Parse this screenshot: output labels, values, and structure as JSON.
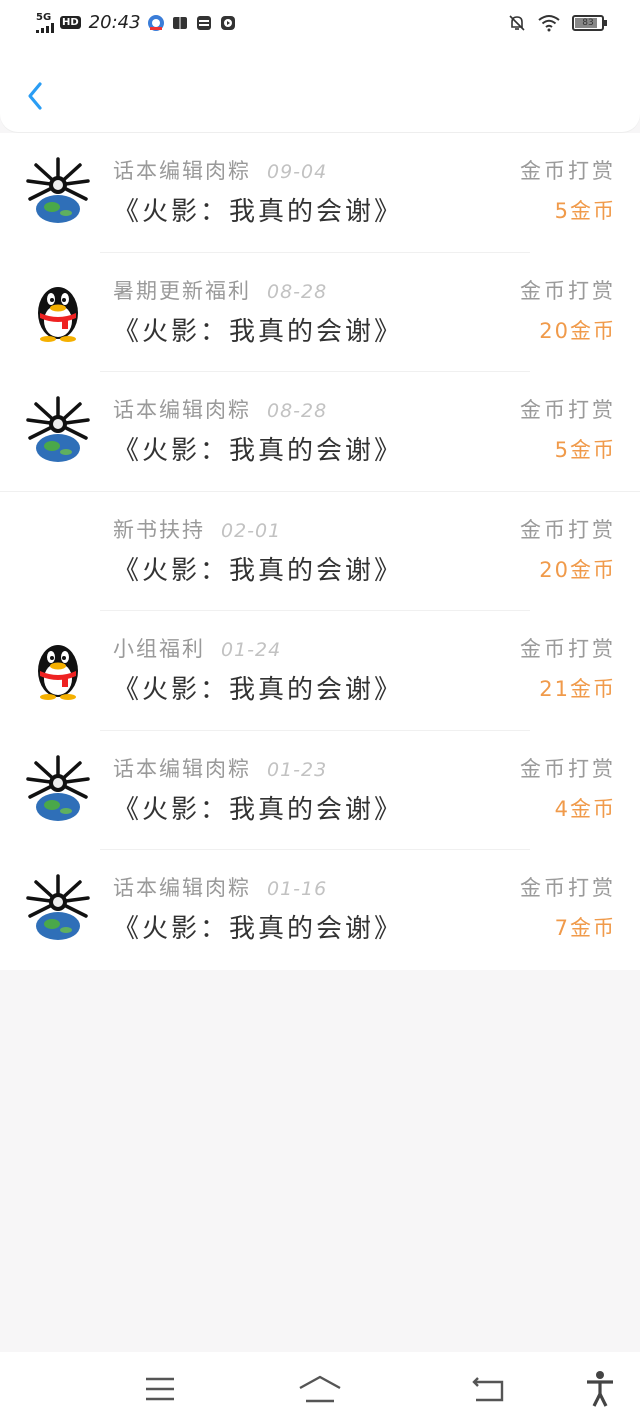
{
  "status": {
    "network": "5G",
    "hd": "HD",
    "time": "20:43",
    "battery": "83"
  },
  "items": [
    {
      "author": "话本编辑肉粽",
      "date": "09-04",
      "title": "《火影：我真的会谢》",
      "reward_label": "金币打赏",
      "amount": "5金币",
      "avatar": "spider-earth"
    },
    {
      "author": "暑期更新福利",
      "date": "08-28",
      "title": "《火影：我真的会谢》",
      "reward_label": "金币打赏",
      "amount": "20金币",
      "avatar": "penguin"
    },
    {
      "author": "话本编辑肉粽",
      "date": "08-28",
      "title": "《火影：我真的会谢》",
      "reward_label": "金币打赏",
      "amount": "5金币",
      "avatar": "spider-earth"
    },
    {
      "author": "新书扶持",
      "date": "02-01",
      "title": "《火影：我真的会谢》",
      "reward_label": "金币打赏",
      "amount": "20金币",
      "avatar": "none"
    },
    {
      "author": "小组福利",
      "date": "01-24",
      "title": "《火影：我真的会谢》",
      "reward_label": "金币打赏",
      "amount": "21金币",
      "avatar": "penguin"
    },
    {
      "author": "话本编辑肉粽",
      "date": "01-23",
      "title": "《火影：我真的会谢》",
      "reward_label": "金币打赏",
      "amount": "4金币",
      "avatar": "spider-earth"
    },
    {
      "author": "话本编辑肉粽",
      "date": "01-16",
      "title": "《火影：我真的会谢》",
      "reward_label": "金币打赏",
      "amount": "7金币",
      "avatar": "spider-earth"
    }
  ],
  "colors": {
    "accent_back": "#2a9df4",
    "amount": "#f09a4a"
  }
}
